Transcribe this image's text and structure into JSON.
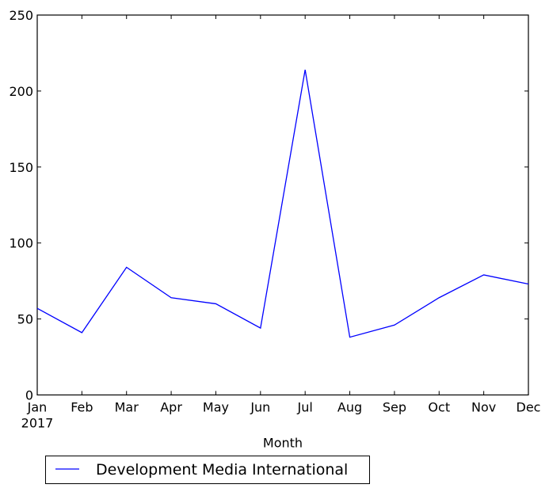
{
  "chart_data": {
    "type": "line",
    "title": "",
    "xlabel": "Month",
    "ylabel": "",
    "categories": [
      "Jan",
      "Feb",
      "Mar",
      "Apr",
      "May",
      "Jun",
      "Jul",
      "Aug",
      "Sep",
      "Oct",
      "Nov",
      "Dec"
    ],
    "x_sublabel": "2017",
    "ylim": [
      0,
      250
    ],
    "yticks": [
      0,
      50,
      100,
      150,
      200,
      250
    ],
    "grid": false,
    "legend_position": "below-left",
    "series": [
      {
        "name": "Development Media International",
        "color": "#0000ff",
        "values": [
          57,
          41,
          84,
          64,
          60,
          44,
          214,
          38,
          46,
          64,
          79,
          73
        ]
      }
    ]
  }
}
